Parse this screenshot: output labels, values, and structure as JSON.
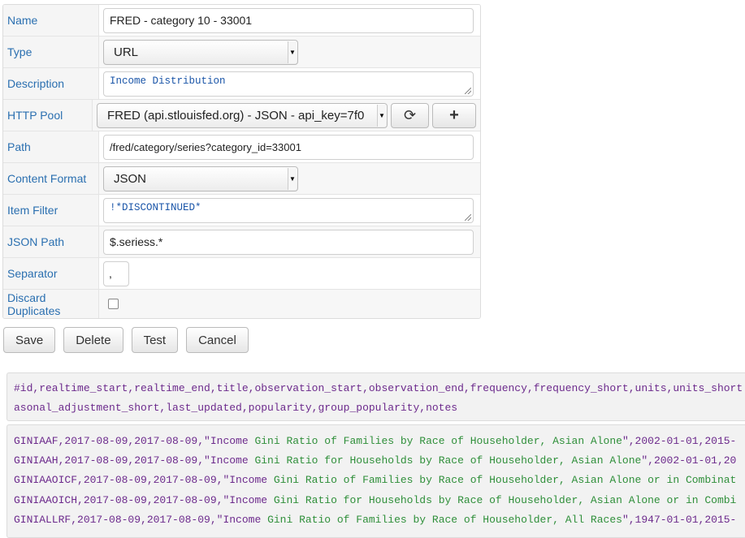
{
  "form": {
    "name": {
      "label": "Name",
      "value": "FRED - category 10 - 33001"
    },
    "type": {
      "label": "Type",
      "value": "URL"
    },
    "description": {
      "label": "Description",
      "value": "Income Distribution"
    },
    "http_pool": {
      "label": "HTTP Pool",
      "value": "FRED (api.stlouisfed.org) - JSON - api_key=7f0"
    },
    "path": {
      "label": "Path",
      "value": "/fred/category/series?category_id=33001"
    },
    "content_format": {
      "label": "Content Format",
      "value": "JSON"
    },
    "item_filter": {
      "label": "Item Filter",
      "value": "!*DISCONTINUED*"
    },
    "json_path": {
      "label": "JSON Path",
      "value": "$.seriess.*"
    },
    "separator": {
      "label": "Separator",
      "value": ","
    },
    "discard_duplicates": {
      "label": "Discard Duplicates",
      "checked": false
    }
  },
  "icons": {
    "refresh": "refresh-icon",
    "add": "plus-icon"
  },
  "buttons": {
    "save": "Save",
    "delete": "Delete",
    "test": "Test",
    "cancel": "Cancel"
  },
  "preview_header": {
    "line1": "#id,realtime_start,realtime_end,title,observation_start,observation_end,frequency,frequency_short,units,units_short",
    "line2": "asonal_adjustment_short,last_updated,popularity,group_popularity,notes"
  },
  "preview_rows": [
    {
      "prefix": "GINIAAF,2017-08-09,2017-08-09,\"Income ",
      "title": "Gini Ratio of Families by Race of Householder, Asian Alone",
      "suffix": "\",2002-01-01,2015-"
    },
    {
      "prefix": "GINIAAH,2017-08-09,2017-08-09,\"Income ",
      "title": "Gini Ratio for Households by Race of Householder, Asian Alone",
      "suffix": "\",2002-01-01,20"
    },
    {
      "prefix": "GINIAAOICF,2017-08-09,2017-08-09,\"Income ",
      "title": "Gini Ratio of Families by Race of Householder, Asian Alone or in Combinat",
      "suffix": ""
    },
    {
      "prefix": "GINIAAOICH,2017-08-09,2017-08-09,\"Income ",
      "title": "Gini Ratio for Households by Race of Householder, Asian Alone or in Combi",
      "suffix": ""
    },
    {
      "prefix": "GINIALLRF,2017-08-09,2017-08-09,\"Income ",
      "title": "Gini Ratio of Families by Race of Householder, All Races",
      "suffix": "\",1947-01-01,2015-"
    }
  ]
}
